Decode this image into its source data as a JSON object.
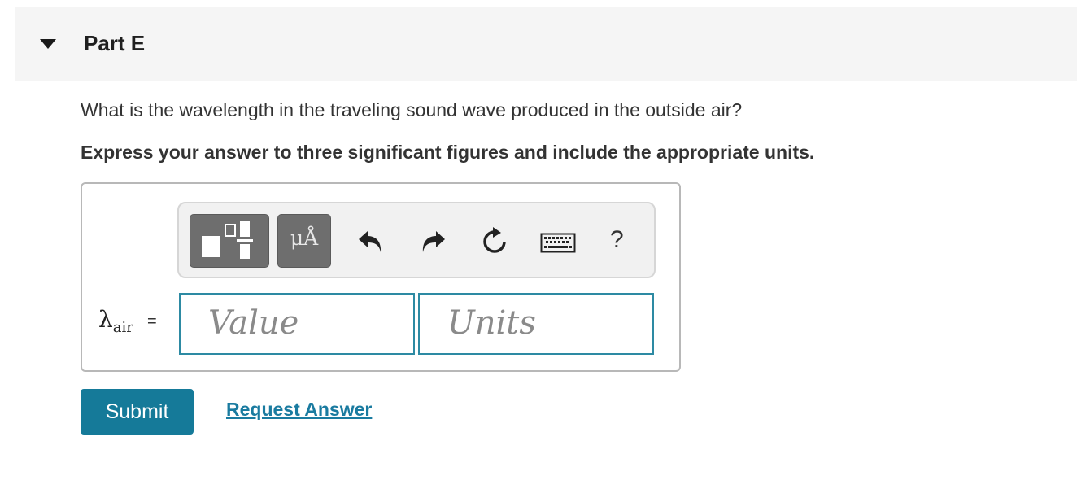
{
  "part": {
    "title": "Part E"
  },
  "question": {
    "text": "What is the wavelength in the traveling sound wave produced in the outside air?",
    "instruction": "Express your answer to three significant figures and include the appropriate units."
  },
  "toolbar": {
    "buttons": [
      {
        "icon": "templates-icon"
      },
      {
        "label": "μÅ",
        "icon": "units-icon"
      },
      {
        "icon": "undo-icon"
      },
      {
        "icon": "redo-icon"
      },
      {
        "icon": "reset-icon"
      },
      {
        "icon": "keyboard-icon"
      },
      {
        "label": "?",
        "icon": "help-icon"
      }
    ]
  },
  "answer": {
    "variable": "λ",
    "subscript": "air",
    "equals": "=",
    "value_placeholder": "Value",
    "units_placeholder": "Units"
  },
  "actions": {
    "submit_label": "Submit",
    "request_label": "Request Answer"
  },
  "colors": {
    "accent": "#157a99",
    "link": "#1a7ba0",
    "field_border": "#2d8aa3",
    "header_bg": "#f5f5f5"
  }
}
